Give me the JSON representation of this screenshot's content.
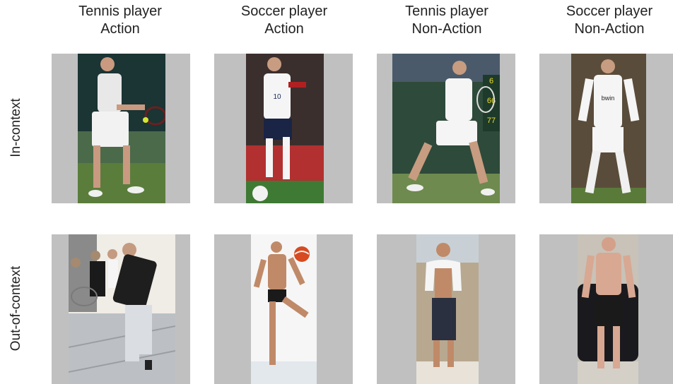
{
  "columns": [
    {
      "line1": "Tennis player",
      "line2": "Action"
    },
    {
      "line1": "Soccer player",
      "line2": "Action"
    },
    {
      "line1": "Tennis player",
      "line2": "Non-Action"
    },
    {
      "line1": "Soccer player",
      "line2": "Non-Action"
    }
  ],
  "rows": [
    {
      "label": "In-context"
    },
    {
      "label": "Out-of-context"
    }
  ]
}
